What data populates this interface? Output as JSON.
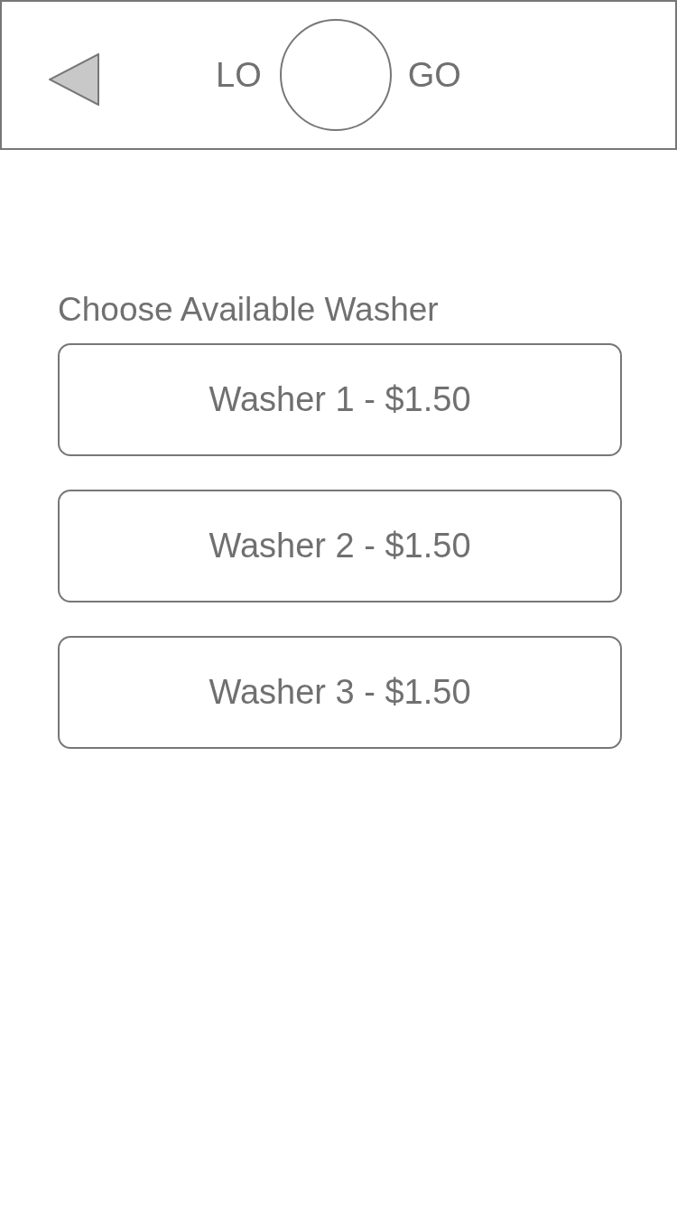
{
  "header": {
    "logo_left": "LO",
    "logo_right": "GO"
  },
  "heading": "Choose Available Washer",
  "washers": [
    {
      "label": "Washer 1 - $1.50"
    },
    {
      "label": "Washer 2 - $1.50"
    },
    {
      "label": "Washer 3 - $1.50"
    }
  ]
}
